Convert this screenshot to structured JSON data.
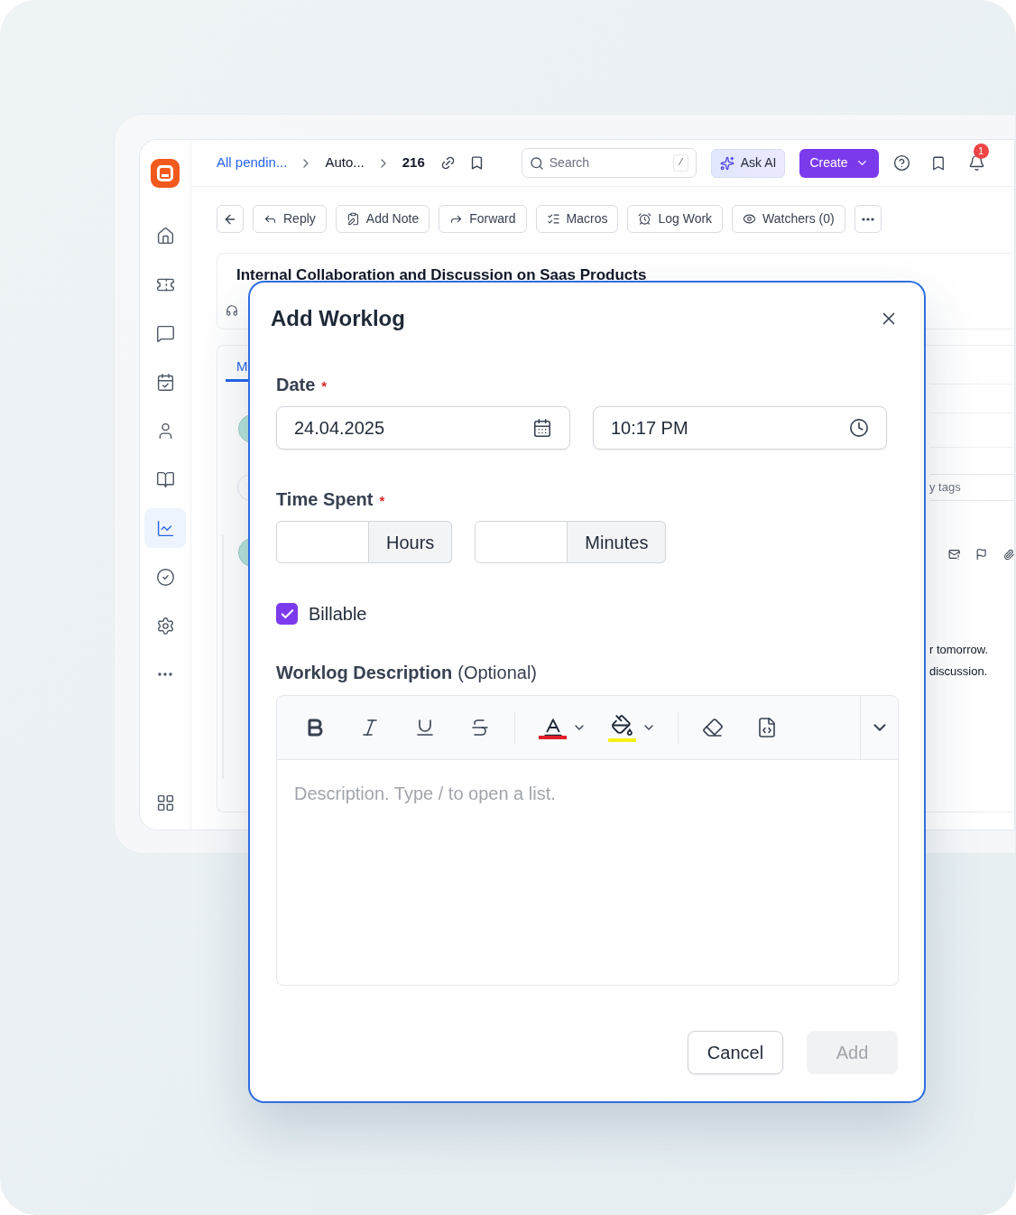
{
  "topbar": {
    "breadcrumbs": [
      "All pendin...",
      "Auto...",
      "216"
    ],
    "search": {
      "placeholder": "Search",
      "shortcut": "/"
    },
    "ask_ai": "Ask AI",
    "create": "Create",
    "notification_count": "1"
  },
  "sidebar": {
    "items": [
      {
        "selected": false
      },
      {
        "selected": false
      },
      {
        "selected": false
      },
      {
        "selected": false
      },
      {
        "selected": false
      },
      {
        "selected": false
      },
      {
        "selected": true
      },
      {
        "selected": false
      },
      {
        "selected": false
      },
      {
        "selected": false
      },
      {
        "selected": false
      }
    ]
  },
  "toolbar": {
    "buttons": [
      "Reply",
      "Add Note",
      "Forward",
      "Macros",
      "Log Work",
      "Watchers (0)"
    ]
  },
  "ticket": {
    "title": "Internal Collaboration and Discussion on Saas Products",
    "tab": "M",
    "tags_field": "y tags",
    "message_lines": [
      "r tomorrow.",
      "discussion."
    ]
  },
  "modal": {
    "title": "Add Worklog",
    "date": {
      "label": "Date",
      "required_mark": "*",
      "date": "24.04.2025",
      "time": "10:17 PM"
    },
    "time_spent": {
      "label": "Time Spent",
      "required_mark": "*",
      "hours_unit": "Hours",
      "minutes_unit": "Minutes"
    },
    "billable": {
      "label": "Billable",
      "checked": true
    },
    "description": {
      "label": "Worklog Description",
      "hint": "(Optional)",
      "placeholder": "Description. Type / to open a list."
    },
    "buttons": [
      {
        "label": "Cancel",
        "disabled": false
      },
      {
        "label": "Add",
        "disabled": true
      }
    ]
  }
}
